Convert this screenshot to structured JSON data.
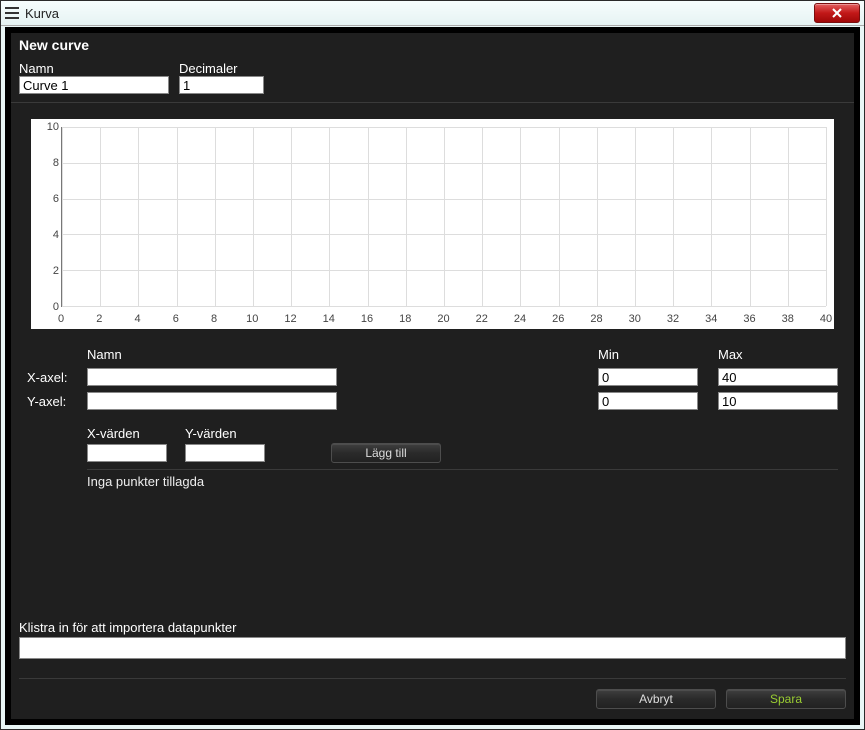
{
  "window": {
    "title": "Kurva"
  },
  "header": {
    "title": "New curve"
  },
  "form": {
    "name_label": "Namn",
    "name_value": "Curve 1",
    "decimals_label": "Decimaler",
    "decimals_value": "1"
  },
  "axes": {
    "col_name": "Namn",
    "col_min": "Min",
    "col_max": "Max",
    "x_label": "X-axel:",
    "x_name": "",
    "x_min": "0",
    "x_max": "40",
    "y_label": "Y-axel:",
    "y_name": "",
    "y_min": "0",
    "y_max": "10"
  },
  "points": {
    "x_header": "X-värden",
    "y_header": "Y-värden",
    "x_value": "",
    "y_value": "",
    "add_button": "Lägg till",
    "empty_message": "Inga punkter tillagda"
  },
  "import": {
    "label": "Klistra in för att importera datapunkter",
    "value": ""
  },
  "footer": {
    "cancel": "Avbryt",
    "save": "Spara"
  },
  "chart_data": {
    "type": "line",
    "title": "",
    "xlabel": "",
    "ylabel": "",
    "xlim": [
      0,
      40
    ],
    "ylim": [
      0,
      10
    ],
    "x_ticks": [
      0,
      2,
      4,
      6,
      8,
      10,
      12,
      14,
      16,
      18,
      20,
      22,
      24,
      26,
      28,
      30,
      32,
      34,
      36,
      38,
      40
    ],
    "y_ticks": [
      0,
      2,
      4,
      6,
      8,
      10
    ],
    "series": []
  }
}
